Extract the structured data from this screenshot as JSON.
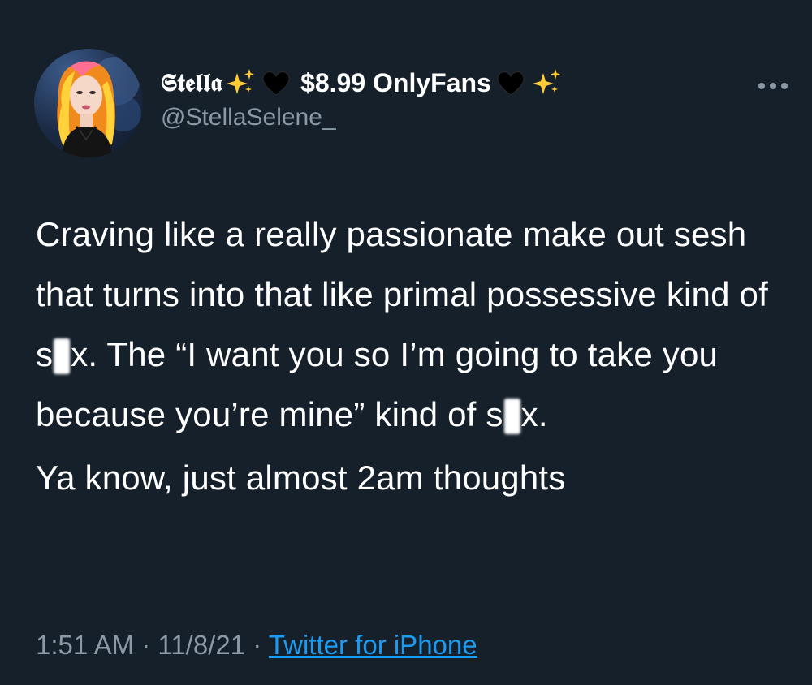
{
  "tweet": {
    "author": {
      "display_name": "𝕾𝖙𝖊𝖑𝖑𝖆",
      "name_suffix": "$8.99 OnlyFans",
      "handle": "@StellaSelene_",
      "name_emojis": [
        "sparkles-icon",
        "black-heart-icon",
        "black-heart-icon",
        "sparkles-icon"
      ]
    },
    "body": {
      "p1_part1": "Craving like a really passionate make out sesh that turns into that like primal possessive kind of s",
      "p1_part2": "x. The “I want you so I’m going to take you because you’re mine” kind of s",
      "p1_part3": "x.",
      "p2": "Ya know, just almost 2am thoughts"
    },
    "meta": {
      "time": "1:51 AM",
      "separator": "·",
      "date": "11/8/21",
      "source": "Twitter for iPhone"
    }
  },
  "colors": {
    "background": "#15202b",
    "text": "#ffffff",
    "secondary_text": "#8b98a5",
    "link": "#1d9bf0"
  }
}
